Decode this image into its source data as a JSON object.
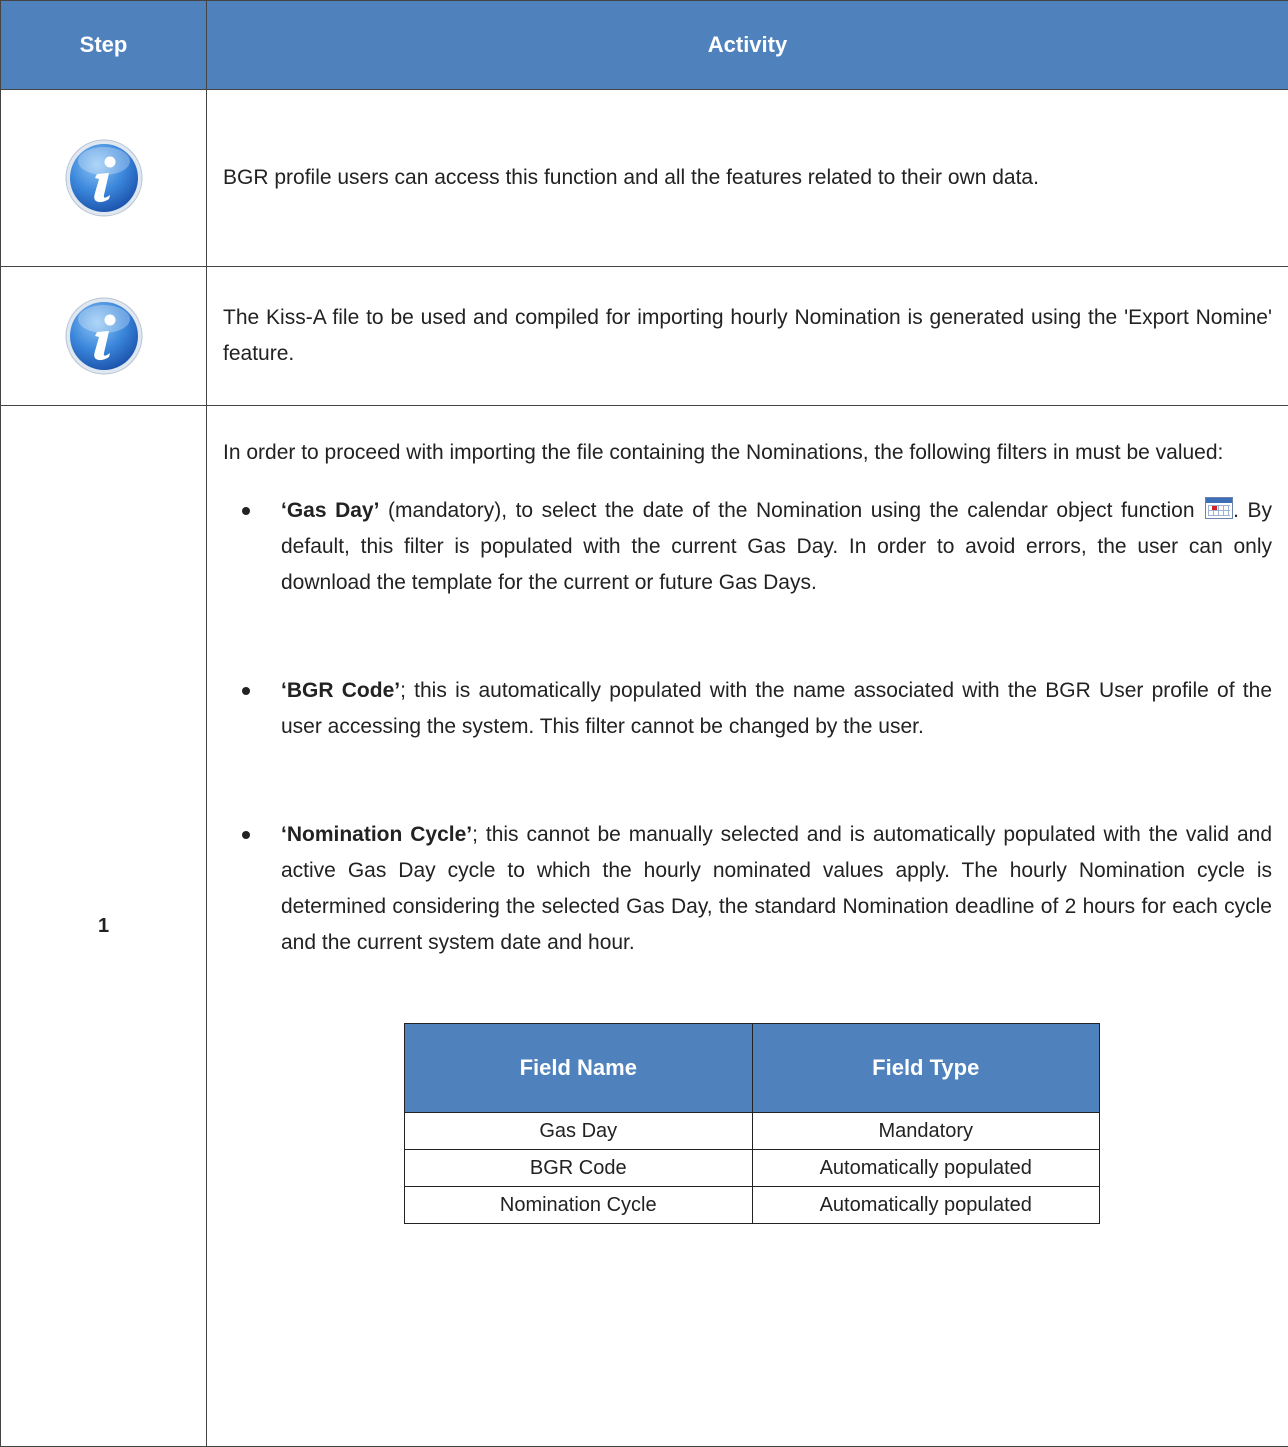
{
  "header": {
    "step": "Step",
    "activity": "Activity"
  },
  "rows": [
    {
      "icon": "info-icon",
      "text": "BGR profile users can access this function and all the features related to their own data."
    },
    {
      "icon": "info-icon",
      "text": "The Kiss-A file to be used and compiled for importing hourly Nomination is generated using the 'Export Nomine' feature."
    },
    {
      "step": "1",
      "intro": "In order to proceed with importing the file containing the Nominations, the following filters in must be valued:",
      "bullets": [
        {
          "label": "‘Gas Day’",
          "text_a": " (mandatory), to select the date of the Nomination using the calendar object function ",
          "icon": "calendar-icon",
          "text_b": ". By default, this filter is populated with the current Gas Day. In order to avoid errors, the user can only download the template for the current or future Gas Days."
        },
        {
          "label": "‘BGR Code’",
          "text": "; this is automatically populated with the name associated with the BGR User profile of the user accessing the system. This filter cannot be changed by the user."
        },
        {
          "label": "‘Nomination Cycle’",
          "text": "; this cannot be manually selected and is automatically populated with the valid and active Gas Day cycle to which the hourly nominated values apply. The hourly Nomination cycle is determined considering the selected Gas Day, the standard Nomination deadline of 2 hours for each cycle  and the current system date and hour."
        }
      ],
      "fields_table": {
        "headers": [
          "Field Name",
          "Field Type"
        ],
        "rows": [
          [
            "Gas Day",
            "Mandatory"
          ],
          [
            "BGR Code",
            "Automatically populated"
          ],
          [
            "Nomination Cycle",
            "Automatically populated"
          ]
        ]
      }
    }
  ]
}
